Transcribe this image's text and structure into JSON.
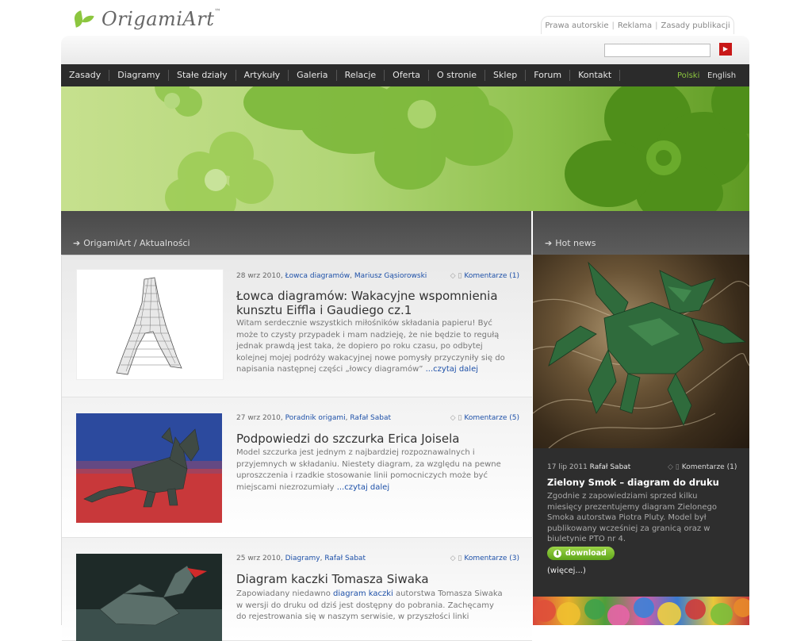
{
  "header": {
    "logo_text": "OrigamiArt",
    "logo_tm": "™",
    "top_links": [
      "Prawa autorskie",
      "Reklama",
      "Zasady publikacji"
    ],
    "search_placeholder": ""
  },
  "nav": {
    "items": [
      "Zasady",
      "Diagramy",
      "Stałe działy",
      "Artykuły",
      "Galeria",
      "Relacje",
      "Oferta",
      "O stronie",
      "Sklep",
      "Forum",
      "Kontakt"
    ],
    "lang_pl": "Polski",
    "lang_en": "English"
  },
  "colors": {
    "accent_green": "#8cc63f",
    "link_blue": "#1d50a8",
    "nav_bg": "#2b2b2b"
  },
  "breadcrumb": "OrigamiArt / Aktualności",
  "posts": [
    {
      "date": "28 wrz 2010,",
      "category": "Łowca diagramów",
      "author": "Mariusz Gąsiorowski",
      "comments": "Komentarze (1)",
      "title": "Łowca diagramów: Wakacyjne wspomnienia kunsztu Eiffla i Gaudiego cz.1",
      "title_line1": "Łowca diagramów: Wakacyjne wspomnienia",
      "title_line2": "kunsztu Eiffla i Gaudiego cz.1",
      "text": "Witam serdecznie wszystkich miłośników składania papieru! Być może to czysty przypadek i mam nadzieję, że nie będzie to regułą jednak prawdą jest taka, że dopiero po roku czasu, po odbytej kolejnej mojej podróży wakacyjnej nowe pomysły przyczyniły się do napisania następnej części „łowcy diagramów”",
      "more": "...czytaj dalej"
    },
    {
      "date": "27 wrz 2010,",
      "category": "Poradnik origami",
      "author": "Rafał Sabat",
      "comments": "Komentarze (5)",
      "title": "Podpowiedzi do szczurka Erica Joisela",
      "text": "Model szczurka jest jednym z najbardziej rozpoznawalnych i przyjemnych w składaniu. Niestety diagram, za względu na pewne uproszczenia i rzadkie stosowanie linii pomocniczych może być miejscami niezrozumiały",
      "more": "...czytaj dalej"
    },
    {
      "date": "25 wrz 2010,",
      "category": "Diagramy",
      "author": "Rafał Sabat",
      "comments": "Komentarze (3)",
      "title": "Diagram kaczki Tomasza Siwaka",
      "text_before": "Zapowiadany niedawno",
      "text_link": "diagram kaczki",
      "text_after": "autorstwa Tomasza Siwaka w wersji do druku od dziś jest dostępny do pobrania. Zachęcamy do rejestrowania się w naszym serwisie, w przyszłości linki"
    }
  ],
  "hot": {
    "title": "Hot news",
    "date": "17 lip 2011",
    "author": "Rafał Sabat",
    "comments": "Komentarze (1)",
    "headline": "Zielony Smok – diagram do druku",
    "text": "Zgodnie z zapowiedziami sprzed kilku miesięcy prezentujemy diagram Zielonego Smoka autorstwa Piotra Pluty. Model był publikowany wcześniej za granicą oraz w biuletynie PTO nr 4.",
    "download": "download",
    "more": "(więcej...)"
  }
}
